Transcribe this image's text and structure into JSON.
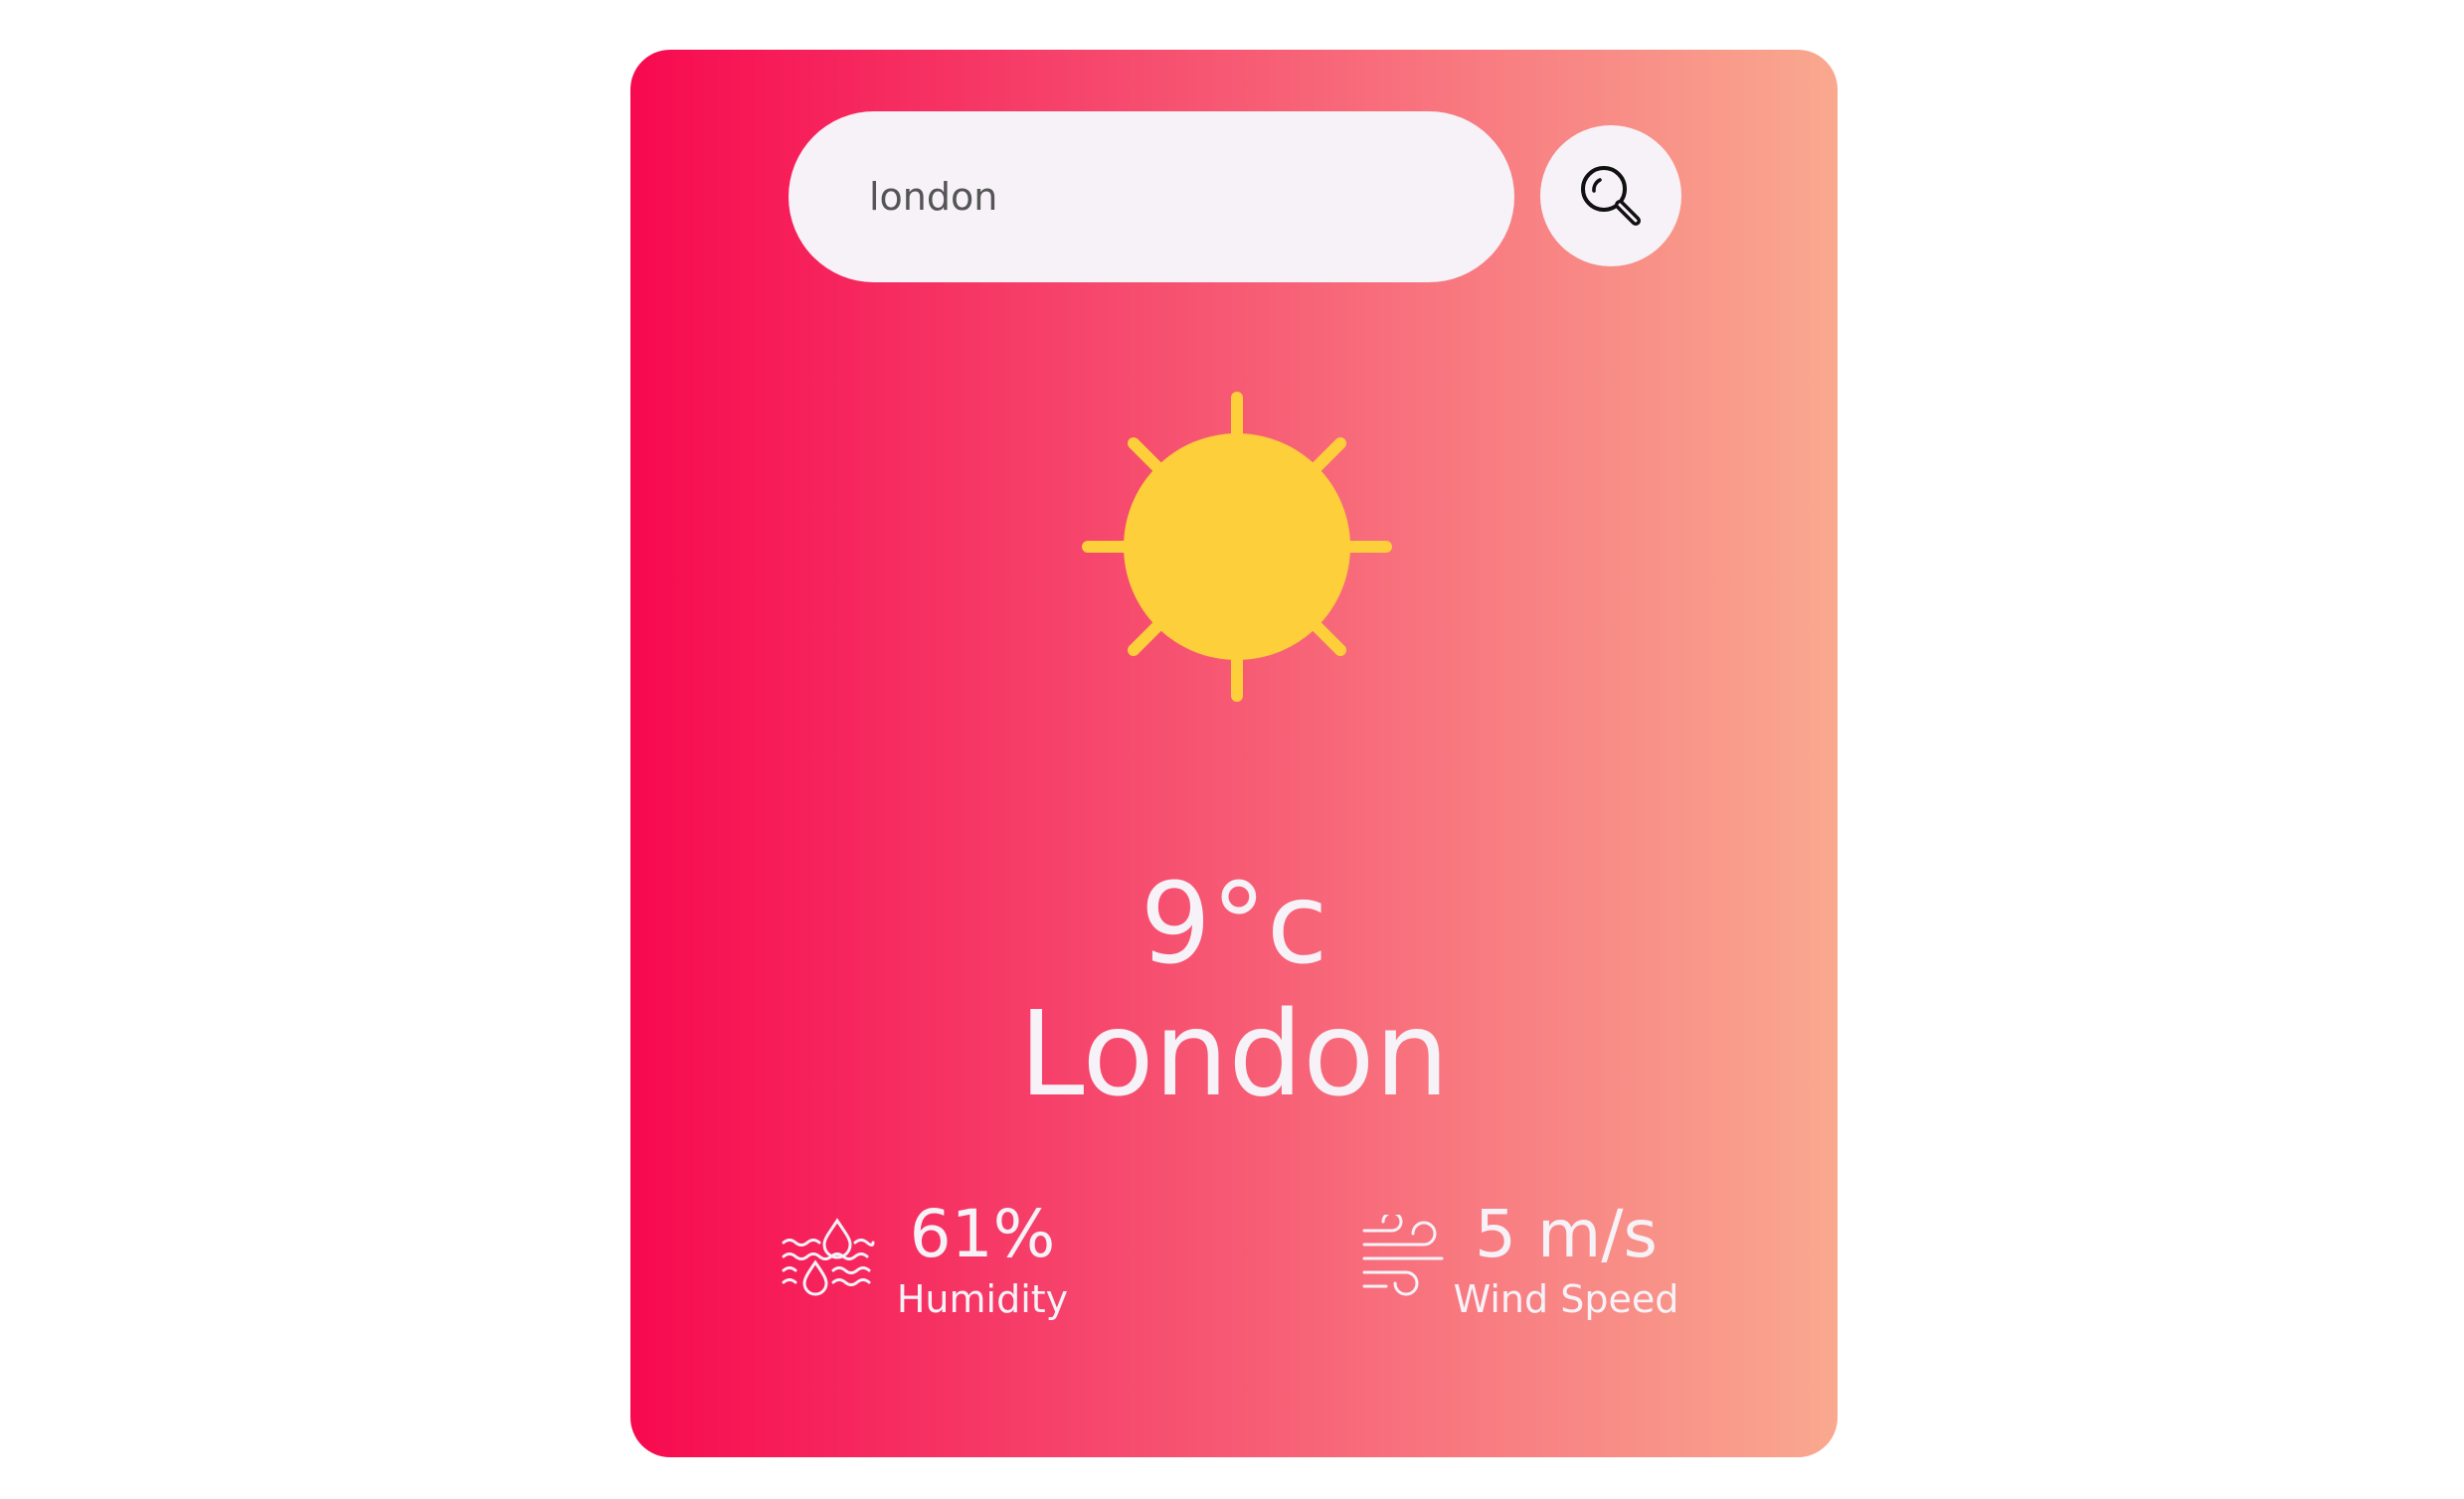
{
  "search": {
    "value": "london"
  },
  "weather": {
    "icon": "sun-icon",
    "temperature": "9°c",
    "city": "London"
  },
  "stats": {
    "humidity": {
      "icon": "humidity-icon",
      "value": "61%",
      "label": "Humidity"
    },
    "wind": {
      "icon": "wind-icon",
      "value": "5 m/s",
      "label": "Wind Speed"
    }
  },
  "colors": {
    "gradient_start": "#f7094f",
    "gradient_end": "#f9a98f",
    "sun": "#fdd03b",
    "text": "#f6f2f8",
    "input_background": "#f6f2f8"
  }
}
